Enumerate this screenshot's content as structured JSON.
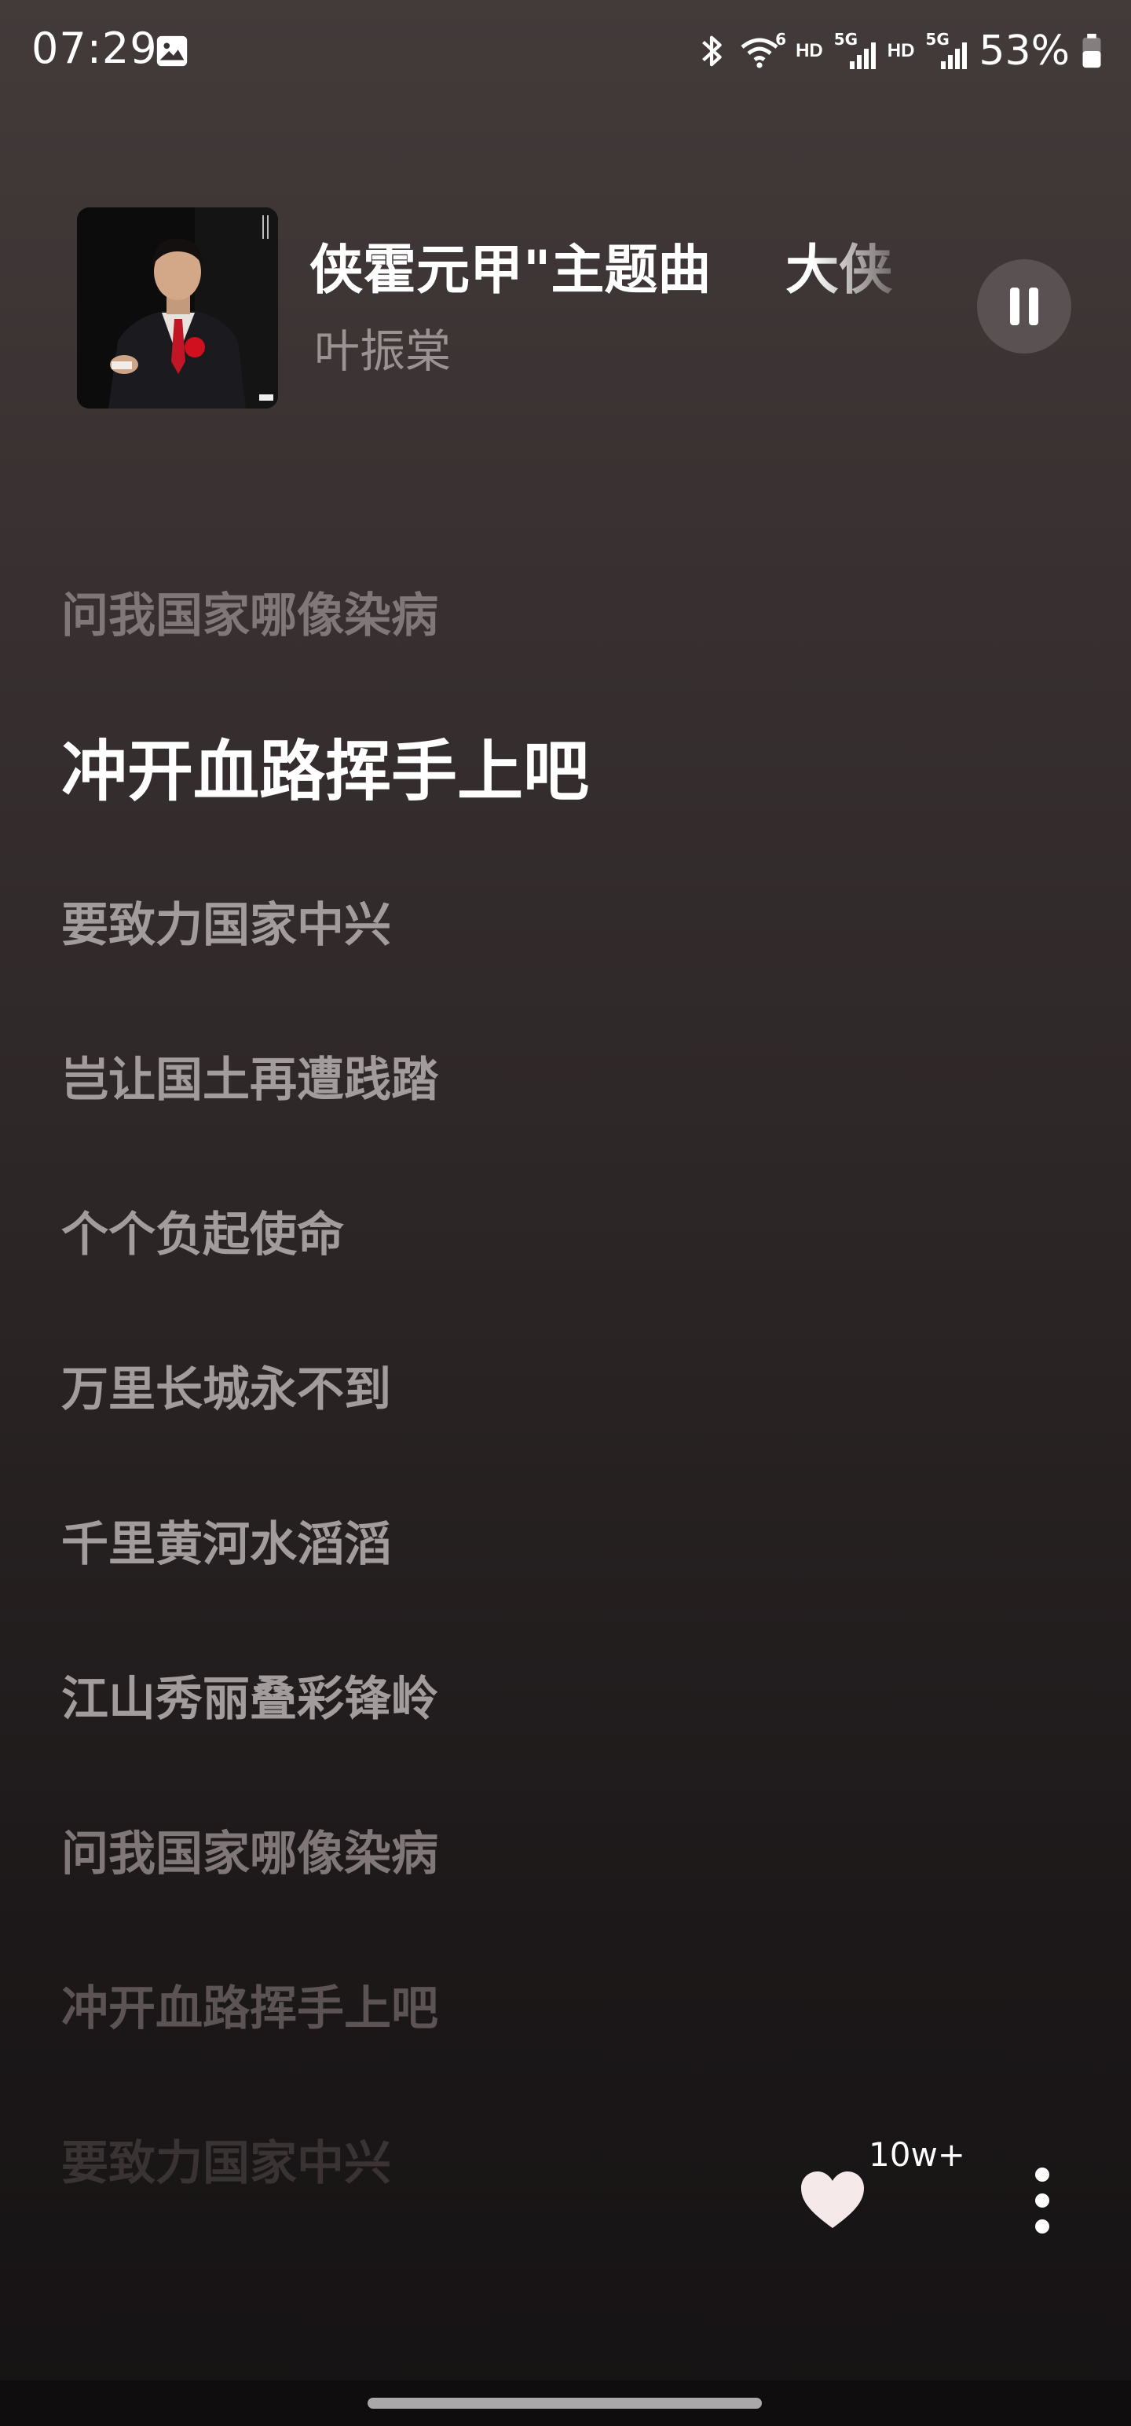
{
  "status_bar": {
    "time": "07:29",
    "hd_1": "HD",
    "hd_2": "HD",
    "network_1": "5G",
    "network_2": "5G",
    "wifi_badge": "6",
    "battery_percent": "53%",
    "icons": [
      "gallery-icon",
      "bluetooth-icon",
      "wifi-icon",
      "signal-icon",
      "signal-icon",
      "battery-icon"
    ]
  },
  "now_playing": {
    "title": "侠霍元甲\"主题曲    大侠",
    "artist": "叶振棠",
    "state": "playing",
    "control_icon": "pause-icon"
  },
  "lyrics": {
    "lines": [
      "问我国家哪像染病",
      "冲开血路挥手上吧",
      "要致力国家中兴",
      "岂让国土再遭践踏",
      "个个负起使命",
      "万里长城永不到",
      "千里黄河水滔滔",
      "江山秀丽叠彩锋岭",
      "问我国家哪像染病",
      "冲开血路挥手上吧",
      "要致力国家中兴"
    ],
    "active_index": 1
  },
  "actions": {
    "like_count": "10w+",
    "like_icon": "heart-icon",
    "more_icon": "more-vertical-icon"
  },
  "colors": {
    "active_lyric": "#ffffff",
    "lyric": "#a39c9d",
    "artist": "#9a9293",
    "pause_button_bg": "#595152"
  }
}
